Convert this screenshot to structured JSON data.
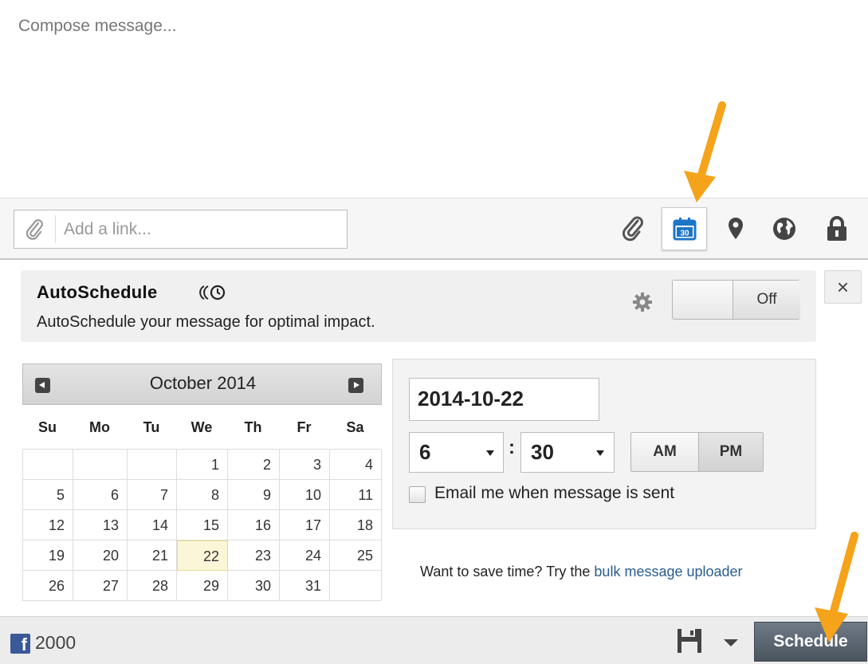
{
  "compose": {
    "placeholder": "Compose message..."
  },
  "link_bar": {
    "placeholder": "Add a link...",
    "tools": [
      "paperclip-icon",
      "calendar-icon",
      "location-pin-icon",
      "globe-icon",
      "lock-icon"
    ],
    "calendar_icon_text": "30"
  },
  "autoschedule": {
    "title": "AutoSchedule",
    "description": "AutoSchedule your message for optimal impact.",
    "toggle_label": "Off",
    "close_label": "×"
  },
  "calendar": {
    "month_label": "October 2014",
    "days_of_week": [
      "Su",
      "Mo",
      "Tu",
      "We",
      "Th",
      "Fr",
      "Sa"
    ],
    "weeks": [
      [
        "",
        "",
        "",
        "1",
        "2",
        "3",
        "4"
      ],
      [
        "5",
        "6",
        "7",
        "8",
        "9",
        "10",
        "11"
      ],
      [
        "12",
        "13",
        "14",
        "15",
        "16",
        "17",
        "18"
      ],
      [
        "19",
        "20",
        "21",
        "22",
        "23",
        "24",
        "25"
      ],
      [
        "26",
        "27",
        "28",
        "29",
        "30",
        "31",
        ""
      ]
    ],
    "selected_day": "22"
  },
  "time_panel": {
    "date_value": "2014-10-22",
    "hour": "6",
    "minute": "30",
    "colon": ":",
    "am_label": "AM",
    "pm_label": "PM",
    "selected_period": "PM",
    "email_label": "Email me when message is sent"
  },
  "bulk": {
    "prefix": "Want to save time? Try the ",
    "link_text": "bulk message uploader"
  },
  "footer": {
    "fb_glyph": "f",
    "char_count": "2000",
    "schedule_label": "Schedule"
  },
  "colors": {
    "facebook": "#3b5998",
    "annotation_arrow": "#f5a31a",
    "calendar_blue": "#1d75c8",
    "link": "#2a5d8f"
  }
}
